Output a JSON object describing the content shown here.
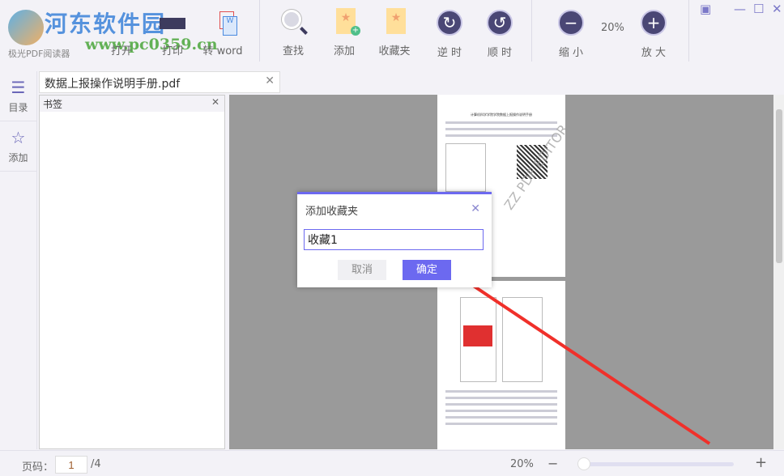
{
  "app": {
    "brand": "极光PDF阅读器",
    "watermark_title": "河东软件园",
    "watermark_url": "www.pc0359.cn"
  },
  "toolbar": {
    "open": "打开",
    "print": "打印",
    "to_word": "转 word",
    "find": "查找",
    "add": "添加",
    "favorites": "收藏夹",
    "ccw": "逆 时",
    "cw": "顺 时",
    "zoom_out": "缩 小",
    "zoom_level": "20%",
    "zoom_in": "放 大"
  },
  "sidebar": {
    "items": [
      {
        "label": "目录",
        "icon": "list-icon"
      },
      {
        "label": "添加",
        "icon": "star-icon"
      }
    ]
  },
  "tab": {
    "label": "数据上报操作说明手册.pdf"
  },
  "bookmark_panel": {
    "title": "书签"
  },
  "page_preview": {
    "title": "计算机科学学院学院数据上报操作说明手册",
    "watermark": "ZZ PDF EDITOR"
  },
  "dialog": {
    "title": "添加收藏夹",
    "input_value": "收藏1",
    "cancel": "取消",
    "ok": "确定"
  },
  "status": {
    "page_label": "页码：",
    "page_value": "1",
    "page_total": "/4",
    "zoom": "20%"
  },
  "colors": {
    "accent": "#6c69f0",
    "icon_dark": "#4a4775",
    "arrow": "#f0302a"
  }
}
